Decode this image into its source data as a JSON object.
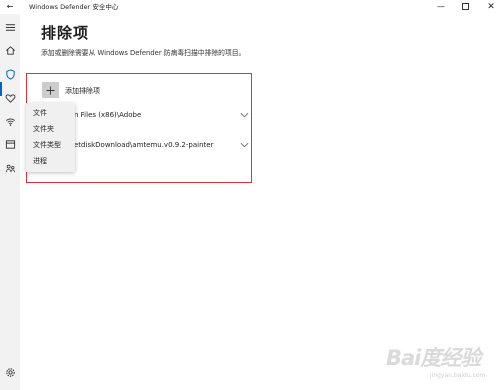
{
  "window": {
    "title": "Windows Defender 安全中心",
    "back_glyph": "←",
    "minimize_glyph": "—",
    "close_glyph": "✕"
  },
  "sidebar": {
    "items": [
      {
        "icon": "hamburger-menu-icon"
      },
      {
        "icon": "home-icon"
      },
      {
        "icon": "shield-icon",
        "active": true
      },
      {
        "icon": "heart-icon"
      },
      {
        "icon": "wifi-icon"
      },
      {
        "icon": "browser-window-icon"
      },
      {
        "icon": "family-icon"
      },
      {
        "icon": "settings-gear-icon"
      }
    ],
    "accent_color": "#0067c0"
  },
  "main": {
    "title": "排除项",
    "description": "添加或删除需要从 Windows Defender 防病毒扫描中排除的项目。",
    "add_button": {
      "icon": "plus-icon",
      "label": "添加排除项"
    },
    "exclusions": [
      {
        "text": "n Files (x86)\\Adobe"
      },
      {
        "text": "etdiskDownload\\amtemu.v0.9.2-painter"
      }
    ],
    "highlight_color": "#e0303a"
  },
  "dropdown_menu": {
    "items": [
      "文件",
      "文件夹",
      "文件类型",
      "进程"
    ]
  },
  "watermark": {
    "main": "Bai度经验",
    "sub": "jingyan.baidu.com"
  }
}
